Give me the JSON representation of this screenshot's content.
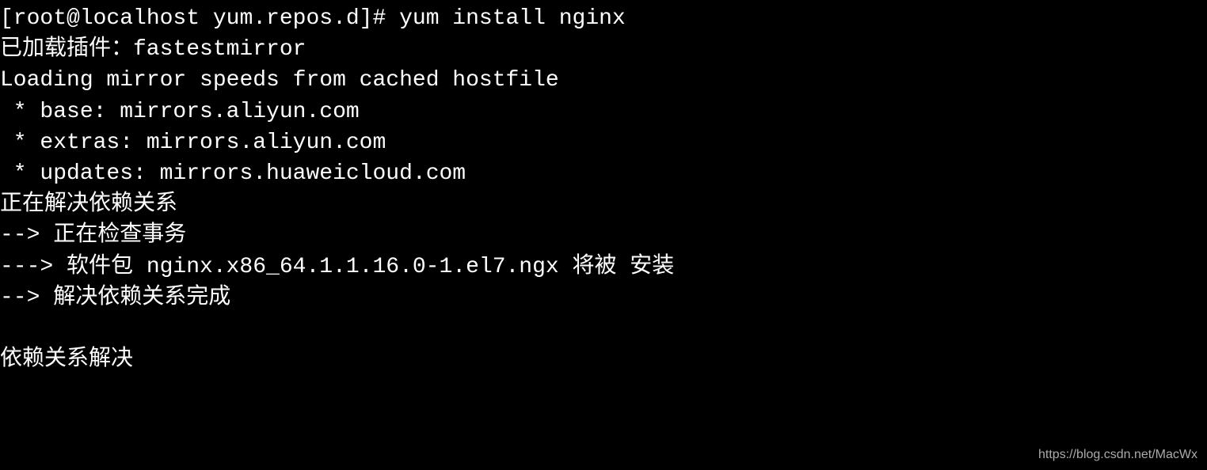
{
  "terminal": {
    "lines": [
      "[root@localhost yum.repos.d]# yum install nginx",
      "已加载插件：fastestmirror",
      "Loading mirror speeds from cached hostfile",
      " * base: mirrors.aliyun.com",
      " * extras: mirrors.aliyun.com",
      " * updates: mirrors.huaweicloud.com",
      "正在解决依赖关系",
      "--> 正在检查事务",
      "---> 软件包 nginx.x86_64.1.1.16.0-1.el7.ngx 将被 安装",
      "--> 解决依赖关系完成",
      "",
      "依赖关系解决"
    ]
  },
  "watermark": "https://blog.csdn.net/MacWx"
}
